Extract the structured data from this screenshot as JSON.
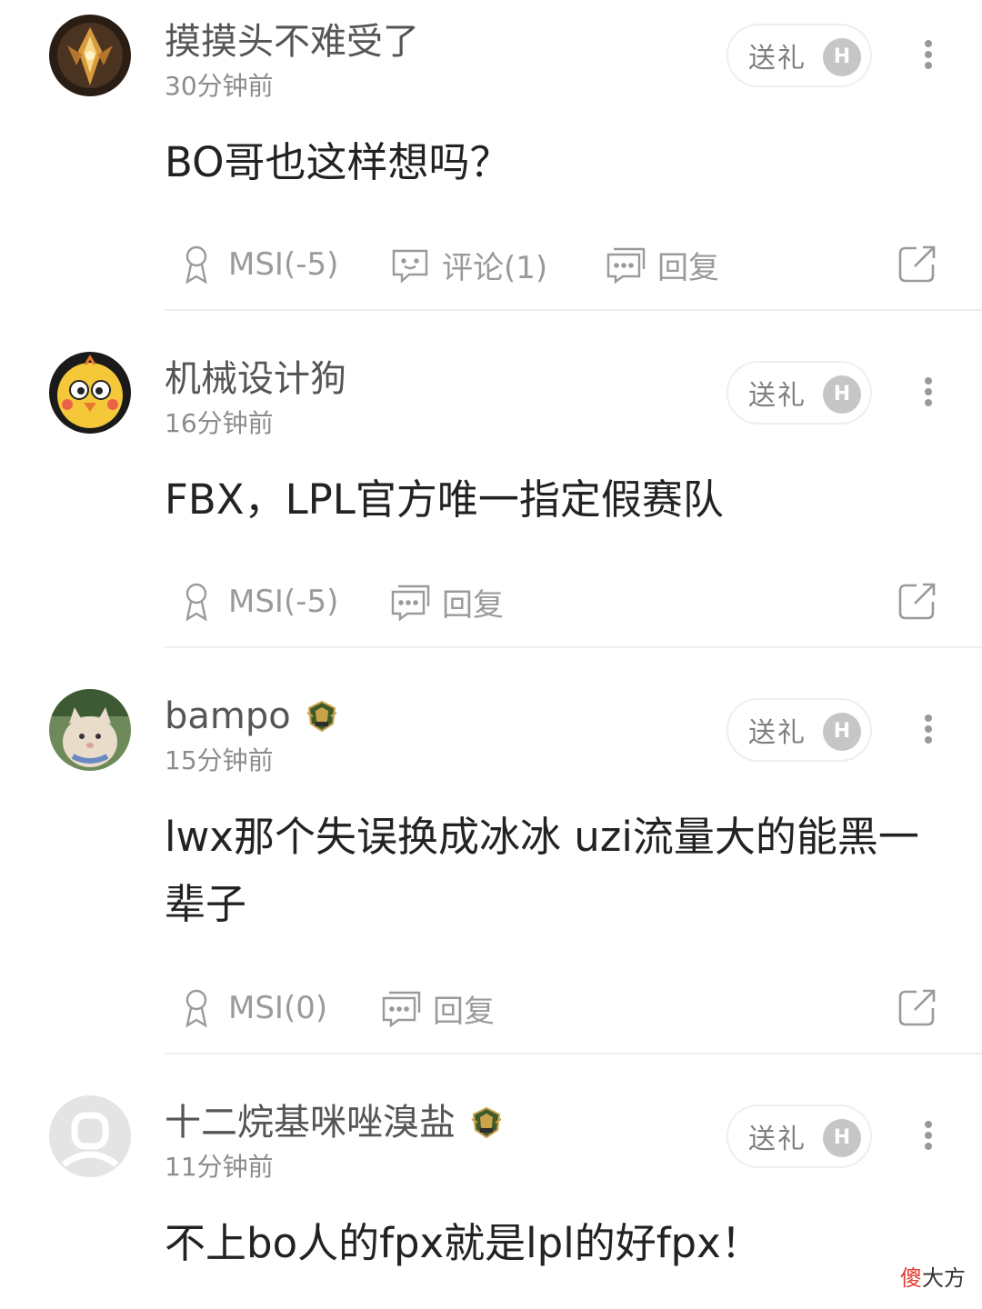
{
  "comments": [
    {
      "username": "摸摸头不难受了",
      "time": "30分钟前",
      "gift_label": "送礼",
      "coin_label": "H",
      "content": "BO哥也这样想吗？",
      "msi_label": "MSI(-5)",
      "comment_label": "评论(1)",
      "reply_label": "回复",
      "has_badge": false
    },
    {
      "username": "机械设计狗",
      "time": "16分钟前",
      "gift_label": "送礼",
      "coin_label": "H",
      "content": "FBX，LPL官方唯一指定假赛队",
      "msi_label": "MSI(-5)",
      "reply_label": "回复",
      "has_badge": false
    },
    {
      "username": "bampo",
      "time": "15分钟前",
      "gift_label": "送礼",
      "coin_label": "H",
      "content": "lwx那个失误换成冰冰 uzi流量大的能黑一辈子",
      "msi_label": "MSI(0)",
      "reply_label": "回复",
      "has_badge": true
    },
    {
      "username": "十二烷基咪唑溴盐",
      "time": "11分钟前",
      "gift_label": "送礼",
      "coin_label": "H",
      "content": "不上bo人的fpx就是lpl的好fpx！",
      "has_badge": true
    }
  ],
  "watermark": {
    "red_part": "傻",
    "dark_part": "大方"
  },
  "colors": {
    "text_primary": "#222222",
    "text_secondary": "#8c8c8c",
    "icon_gray": "#9a9a9a",
    "divider": "#eeeeee",
    "coin_gray": "#c6c6c6",
    "watermark_red": "#e33b2e"
  }
}
